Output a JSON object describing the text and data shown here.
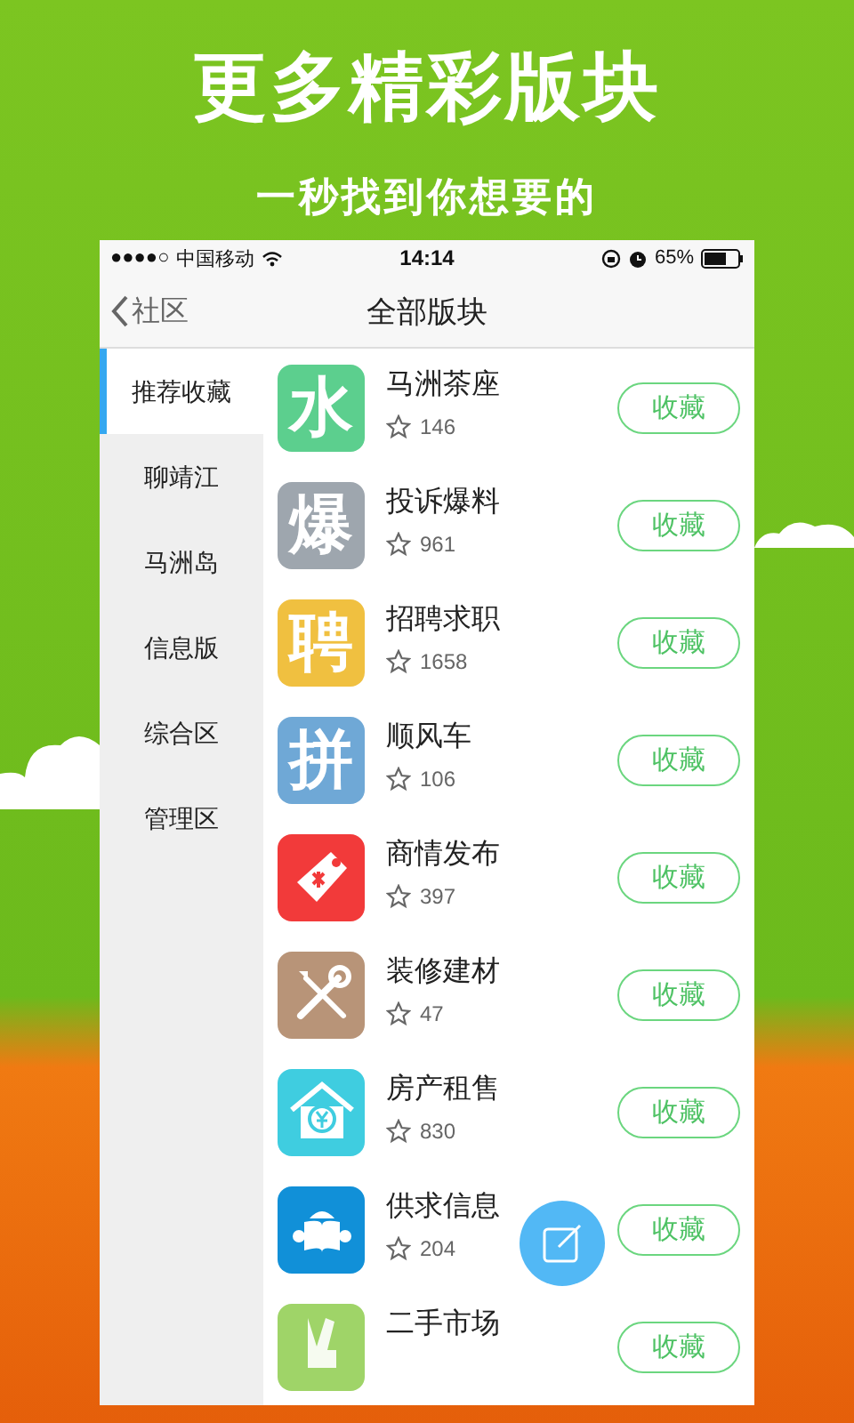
{
  "promo": {
    "headline": "更多精彩版块",
    "subtitle": "一秒找到你想要的"
  },
  "status_bar": {
    "signal": "●●●●○",
    "carrier": "中国移动",
    "time": "14:14",
    "battery": "65%"
  },
  "nav": {
    "back_label": "社区",
    "title": "全部版块"
  },
  "sidebar": {
    "items": [
      {
        "label": "推荐收藏",
        "selected": true
      },
      {
        "label": "聊靖江",
        "selected": false
      },
      {
        "label": "马洲岛",
        "selected": false
      },
      {
        "label": "信息版",
        "selected": false
      },
      {
        "label": "综合区",
        "selected": false
      },
      {
        "label": "管理区",
        "selected": false
      }
    ]
  },
  "boards": [
    {
      "name": "马洲茶座",
      "count": "146",
      "button": "收藏",
      "kind": "glyph",
      "glyph": "水",
      "color": "#5ccf8e"
    },
    {
      "name": "投诉爆料",
      "count": "961",
      "button": "收藏",
      "kind": "glyph",
      "glyph": "爆",
      "color": "#9ea6ae"
    },
    {
      "name": "招聘求职",
      "count": "1658",
      "button": "收藏",
      "kind": "glyph",
      "glyph": "聘",
      "color": "#f0c040"
    },
    {
      "name": "顺风车",
      "count": "106",
      "button": "收藏",
      "kind": "glyph",
      "glyph": "拼",
      "color": "#6fa8d6"
    },
    {
      "name": "商情发布",
      "count": "397",
      "button": "收藏",
      "kind": "tag",
      "color": "#f23a3a"
    },
    {
      "name": "装修建材",
      "count": "47",
      "button": "收藏",
      "kind": "tools",
      "color": "#b89478"
    },
    {
      "name": "房产租售",
      "count": "830",
      "button": "收藏",
      "kind": "house",
      "color": "#3fcde0"
    },
    {
      "name": "供求信息",
      "count": "204",
      "button": "收藏",
      "kind": "reader",
      "color": "#1190d8"
    },
    {
      "name": "二手市场",
      "button": "收藏",
      "kind": "hand",
      "color": "#9fd468"
    }
  ]
}
